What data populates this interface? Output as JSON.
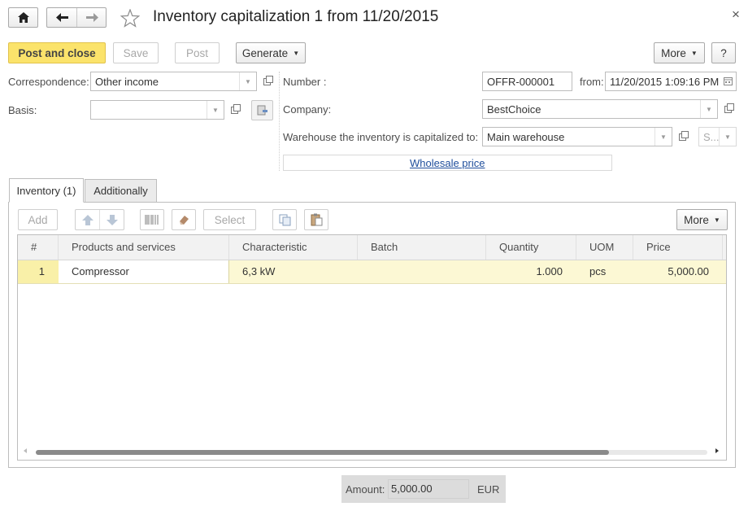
{
  "window": {
    "title": "Inventory capitalization 1 from 11/20/2015",
    "close_glyph": "×"
  },
  "nav": {
    "home_icon": "home-icon",
    "back_icon": "arrow-left-icon",
    "forward_icon": "arrow-right-icon",
    "favorite_icon": "star-icon"
  },
  "toolbar": {
    "post_and_close": "Post and close",
    "save": "Save",
    "post": "Post",
    "generate": "Generate",
    "more": "More",
    "help": "?"
  },
  "form": {
    "correspondence_label": "Correspondence:",
    "correspondence_value": "Other income",
    "basis_label": "Basis:",
    "basis_value": "",
    "number_label": "Number :",
    "number_value": "OFFR-000001",
    "from_label": "from:",
    "date_value": "11/20/2015  1:09:16 PM",
    "company_label": "Company:",
    "company_value": "BestChoice",
    "warehouse_label": "Warehouse the inventory is capitalized to:",
    "warehouse_value": "Main warehouse",
    "storage_bin_value": "S...",
    "price_kind_link": "Wholesale price"
  },
  "tabs": [
    {
      "label": "Inventory (1)",
      "active": true
    },
    {
      "label": "Additionally",
      "active": false
    }
  ],
  "table_toolbar": {
    "add": "Add",
    "select": "Select",
    "more": "More"
  },
  "table": {
    "columns": [
      "#",
      "Products and services",
      "Characteristic",
      "Batch",
      "Quantity",
      "UOM",
      "Price"
    ],
    "rows": [
      {
        "num": "1",
        "product": "Compressor",
        "characteristic": "6,3 kW",
        "batch": "",
        "quantity": "1.000",
        "uom": "pcs",
        "price": "5,000.00"
      }
    ]
  },
  "footer": {
    "amount_label": "Amount:",
    "amount_value": "5,000.00",
    "currency": "EUR"
  },
  "colors": {
    "accent": "#fbe36b",
    "row_highlight": "#fcf8d4",
    "link": "#1f4e9c"
  }
}
